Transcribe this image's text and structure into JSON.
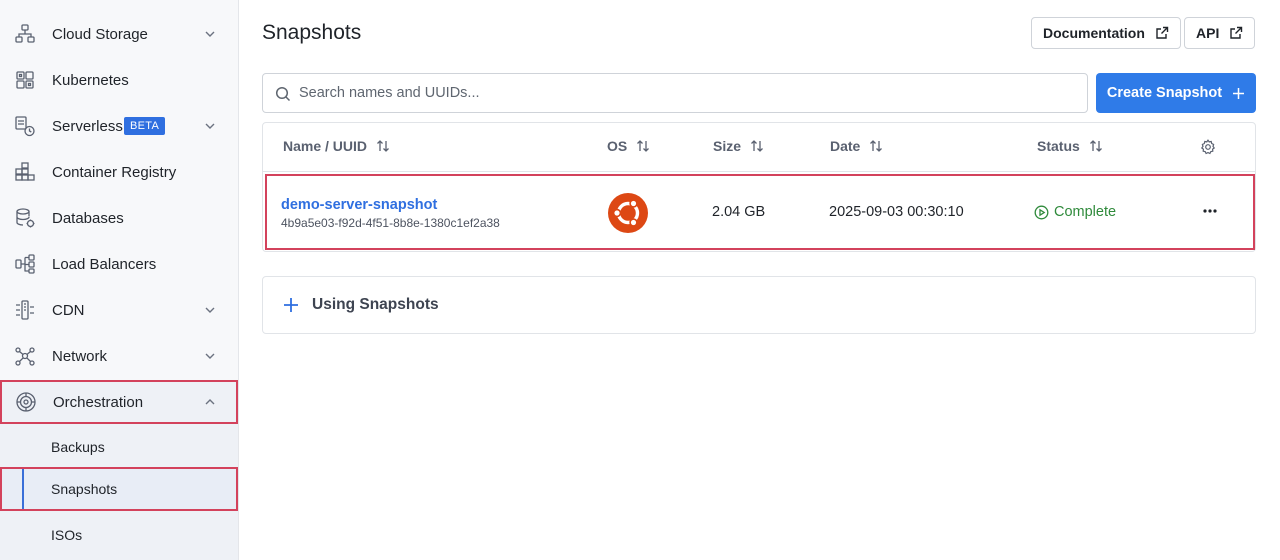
{
  "sidebar": {
    "items": [
      {
        "label": "Cloud Storage",
        "icon": "cloud-storage-icon"
      },
      {
        "label": "Kubernetes",
        "icon": "kubernetes-icon"
      },
      {
        "label": "Serverless",
        "icon": "serverless-icon",
        "badge": "BETA"
      },
      {
        "label": "Container Registry",
        "icon": "container-registry-icon"
      },
      {
        "label": "Databases",
        "icon": "databases-icon"
      },
      {
        "label": "Load Balancers",
        "icon": "load-balancers-icon"
      },
      {
        "label": "CDN",
        "icon": "cdn-icon"
      },
      {
        "label": "Network",
        "icon": "network-icon"
      },
      {
        "label": "Orchestration",
        "icon": "orchestration-icon"
      }
    ],
    "subitems": [
      {
        "label": "Backups"
      },
      {
        "label": "Snapshots"
      },
      {
        "label": "ISOs"
      }
    ]
  },
  "header": {
    "title": "Snapshots",
    "documentation_label": "Documentation",
    "api_label": "API"
  },
  "search": {
    "placeholder": "Search names and UUIDs...",
    "value": ""
  },
  "create_button": {
    "label": "Create Snapshot"
  },
  "table": {
    "columns": [
      "Name / UUID",
      "OS",
      "Size",
      "Date",
      "Status"
    ],
    "rows": [
      {
        "name": "demo-server-snapshot",
        "uuid": "4b9a5e03-f92d-4f51-8b8e-1380c1ef2a38",
        "os": "ubuntu-logo",
        "size": "2.04 GB",
        "date": "2025-09-03 00:30:10",
        "status": "Complete"
      }
    ]
  },
  "accordion": {
    "label": "Using Snapshots"
  },
  "colors": {
    "accent": "#2f7be8",
    "link": "#2f6fe0",
    "status_complete": "#2f8a3b",
    "highlight": "#d3425c",
    "ubuntu": "#dd4814",
    "badge": "#2f6fe0"
  }
}
